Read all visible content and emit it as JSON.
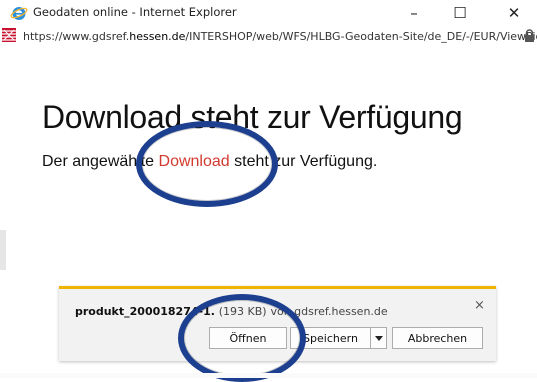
{
  "window": {
    "title": "Geodaten online - Internet Explorer",
    "controls": [
      "–",
      "☐",
      "✕"
    ]
  },
  "address": {
    "url_prefix": "https://www.gdsref.",
    "url_domain": "hessen.de",
    "url_suffix": "/INTERSHOP/web/WFS/HLBG-Geodaten-Site/de_DE/-/EUR/ViewPicl"
  },
  "page": {
    "heading": "Download steht zur Verfügung",
    "sub_before": "Der angewählte ",
    "sub_link": "Download",
    "sub_after": " steht zur Verfügung."
  },
  "download_bar": {
    "filename": "produkt_200018274-1.",
    "size": "(193 KB)",
    "source": "von gdsref.hessen.de",
    "open_label": "Öffnen",
    "save_label": "Speichern",
    "cancel_label": "Abbrechen",
    "close_glyph": "×"
  },
  "colors": {
    "link": "#d23a2f",
    "annotation_ring": "#1d3f8f",
    "download_bar_accent": "#f0b400"
  }
}
